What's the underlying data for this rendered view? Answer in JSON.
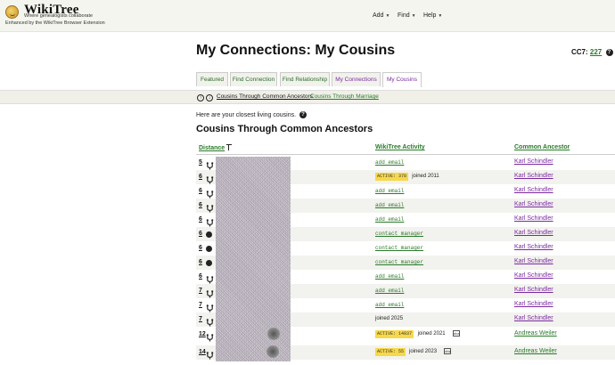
{
  "header": {
    "brand": "WikiTree",
    "tagline": "Where genealogists collaborate",
    "enhanced": "Enhanced by the WikiTree Browser Extension",
    "nav": [
      {
        "label": "Add"
      },
      {
        "label": "Find"
      },
      {
        "label": "Help"
      }
    ]
  },
  "page": {
    "title": "My Connections: My Cousins",
    "cc7_label": "CC7:",
    "cc7_value": "227"
  },
  "tabs": [
    {
      "label": "Featured",
      "active": false
    },
    {
      "label": "Find Connection",
      "active": false
    },
    {
      "label": "Find Relationship",
      "active": false
    },
    {
      "label": "My Connections",
      "active": false
    },
    {
      "label": "My Cousins",
      "active": true
    }
  ],
  "subnav": {
    "links": [
      "Cousins Through Common Ancestors",
      "Cousins Through Marriage"
    ]
  },
  "intro": "Here are your closest living cousins.",
  "section_title": "Cousins Through Common Ancestors",
  "table": {
    "columns": [
      "Distance",
      "WikiTree Activity",
      "Common Ancestor"
    ],
    "rows": [
      {
        "distance": "5",
        "icon": "tree",
        "activity": "add email",
        "ancestor": "Karl Schindler"
      },
      {
        "distance": "6",
        "icon": "tree",
        "activity_badge": "ACTIVE: 378",
        "joined": "joined 2011",
        "ancestor": "Karl Schindler"
      },
      {
        "distance": "6",
        "icon": "tree",
        "activity": "add email",
        "ancestor": "Karl Schindler"
      },
      {
        "distance": "6",
        "icon": "tree",
        "activity": "add email",
        "ancestor": "Karl Schindler"
      },
      {
        "distance": "6",
        "icon": "tree",
        "activity": "add email",
        "ancestor": "Karl Schindler"
      },
      {
        "distance": "6",
        "icon": "dot",
        "activity": "contact manager",
        "ancestor": "Karl Schindler"
      },
      {
        "distance": "6",
        "icon": "dot",
        "activity": "contact manager",
        "ancestor": "Karl Schindler"
      },
      {
        "distance": "6",
        "icon": "dot",
        "activity": "contact manager",
        "ancestor": "Karl Schindler"
      },
      {
        "distance": "6",
        "icon": "tree",
        "activity": "add email",
        "ancestor": "Karl Schindler"
      },
      {
        "distance": "7",
        "icon": "tree",
        "activity": "add email",
        "ancestor": "Karl Schindler"
      },
      {
        "distance": "7",
        "icon": "tree",
        "activity": "add email",
        "ancestor": "Karl Schindler"
      },
      {
        "distance": "7",
        "icon": "tree",
        "joined": "joined 2025",
        "ancestor": "Karl Schindler"
      },
      {
        "distance": "12",
        "icon": "tree",
        "activity_badge": "ACTIVE: 14837",
        "joined": "joined 2021",
        "ancestor": "Andreas Weiler"
      },
      {
        "distance": "14",
        "icon": "tree",
        "activity_badge": "ACTIVE: 55",
        "joined": "joined 2023",
        "ancestor": "Andreas Weiler"
      }
    ]
  }
}
